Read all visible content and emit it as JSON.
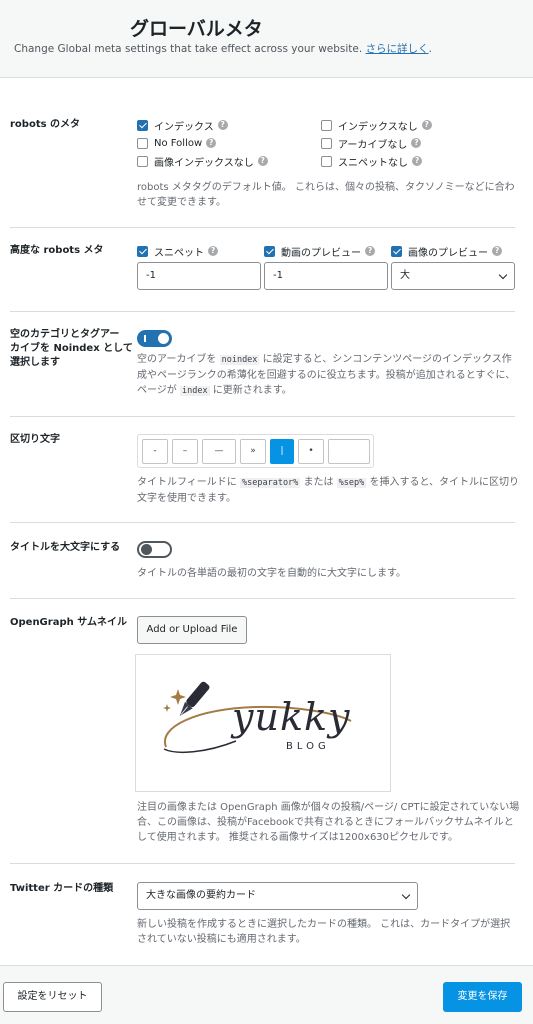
{
  "header": {
    "title": "グローバルメタ",
    "description": "Change Global meta settings that take effect across your website.",
    "learn_more": "さらに詳しく"
  },
  "robots_meta": {
    "label": "robots のメタ",
    "options": [
      {
        "label": "インデックス",
        "checked": true
      },
      {
        "label": "インデックスなし",
        "checked": false
      },
      {
        "label": "No Follow",
        "checked": false
      },
      {
        "label": "アーカイブなし",
        "checked": false
      },
      {
        "label": "画像インデックスなし",
        "checked": false
      },
      {
        "label": "スニペットなし",
        "checked": false
      }
    ],
    "help": [
      "robots メタタグのデフォルト値。 これらは、個々の投稿、タクソノミーなどに合わ",
      "せて変更できます。"
    ]
  },
  "advanced_robots": {
    "label": "高度な robots メタ",
    "options": [
      {
        "label": "スニペット",
        "checked": true
      },
      {
        "label": "動画のプレビュー",
        "checked": true
      },
      {
        "label": "画像のプレビュー",
        "checked": true
      }
    ],
    "snippet_value": "-1",
    "video_value": "-1",
    "image_value": "大"
  },
  "noindex_empty": {
    "label": [
      "空のカテゴリとタグアー",
      "カイブを Noindex として",
      "選択します"
    ],
    "enabled": true,
    "help1_a": "空のアーカイブを",
    "help1_code": "noindex",
    "help1_b": "に設定すると、シンコンテンツページのインデックス作",
    "help2": "成やページランクの希薄化を回避するのに役立ちます。投稿が追加されるとすぐに、",
    "help3_a": "ページが",
    "help3_code": "index",
    "help3_b": "に更新されます。"
  },
  "separator": {
    "label": "区切り文字",
    "options": [
      "-",
      "–",
      "—",
      "»",
      "|",
      "•",
      ""
    ],
    "active_index": 4,
    "help1_a": "タイトルフィールドに",
    "help1_code1": "%separator%",
    "help1_mid": "または",
    "help1_code2": "%sep%",
    "help1_b": "を挿入すると、タイトルに区切り",
    "help2": "文字を使用できます。"
  },
  "capitalize": {
    "label": "タイトルを大文字にする",
    "enabled": false,
    "help": "タイトルの各単語の最初の文字を自動的に大文字にします。"
  },
  "opengraph": {
    "label": "OpenGraph サムネイル",
    "upload_button": "Add or Upload File",
    "logo_main": "yukky",
    "logo_sub": "BLOG",
    "help": [
      "注目の画像または OpenGraph 画像が個々の投稿/ページ/ CPTに設定されていない場",
      "合、この画像は、投稿がFacebookで共有されるときにフォールバックサムネイルと",
      "して使用されます。 推奨される画像サイズは1200x630ピクセルです。"
    ]
  },
  "twitter": {
    "label": "Twitter カードの種類",
    "value": "大きな画像の要約カード",
    "help": [
      "新しい投稿を作成するときに選択したカードの種類。 これは、カードタイプが選択",
      "されていない投稿にも適用されます。"
    ]
  },
  "footer": {
    "reset_label": "設定をリセット",
    "save_label": "変更を保存"
  },
  "colors": {
    "accent": "#0693e3",
    "primary": "#2271b1",
    "border": "#dcdcde"
  },
  "icons": [
    "help-icon",
    "checkbox-check-icon",
    "chevron-down-icon",
    "pen-logo-icon"
  ]
}
